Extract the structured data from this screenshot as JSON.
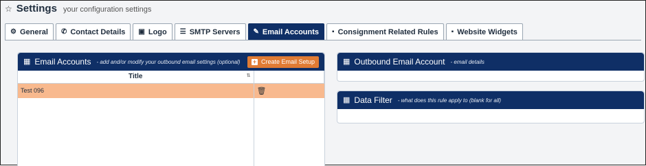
{
  "header": {
    "title": "Settings",
    "subtitle": "your configuration settings",
    "icon": "star-icon"
  },
  "tabs": [
    {
      "label": "General",
      "icon": "gear-icon",
      "active": false
    },
    {
      "label": "Contact Details",
      "icon": "phone-icon",
      "active": false
    },
    {
      "label": "Logo",
      "icon": "image-icon",
      "active": false
    },
    {
      "label": "SMTP Servers",
      "icon": "server-icon",
      "active": false
    },
    {
      "label": "Email Accounts",
      "icon": "paperclip-icon",
      "active": true
    },
    {
      "label": "Consignment Related Rules",
      "icon": "document-icon",
      "active": false
    },
    {
      "label": "Website Widgets",
      "icon": "document-icon",
      "active": false
    }
  ],
  "email_accounts": {
    "title": "Email Accounts",
    "description": "- add and/or modify your outbound email settings (optional)",
    "create_button": "Create Email Setup",
    "columns": [
      "Title",
      ""
    ],
    "rows": [
      {
        "title": "Test 096",
        "selected": true
      }
    ]
  },
  "outbound": {
    "title": "Outbound Email Account",
    "description": "- email details"
  },
  "data_filter": {
    "title": "Data Filter",
    "description": "- what does this rule apply to (blank for all)"
  },
  "colors": {
    "nav_blue": "#0f2f66",
    "accent_orange": "#e07b34",
    "selected_row": "#f8b98e"
  }
}
